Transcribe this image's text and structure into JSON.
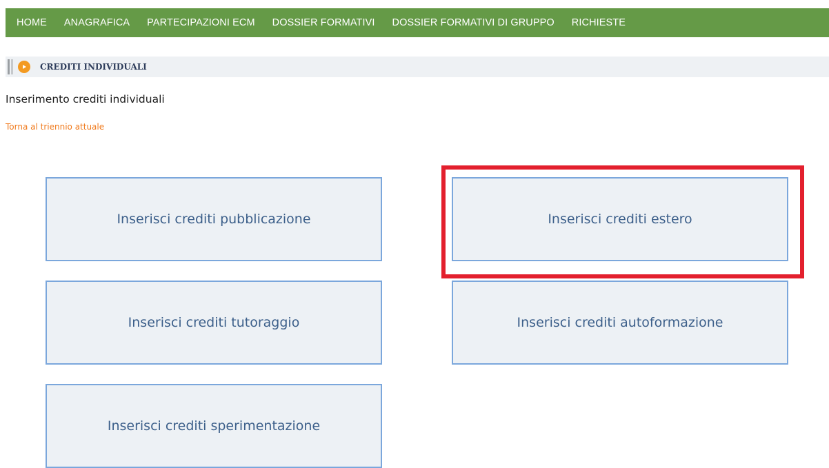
{
  "nav": {
    "items": [
      {
        "label": "HOME"
      },
      {
        "label": "ANAGRAFICA"
      },
      {
        "label": "PARTECIPAZIONI ECM"
      },
      {
        "label": "DOSSIER FORMATIVI"
      },
      {
        "label": "DOSSIER FORMATIVI DI GRUPPO"
      },
      {
        "label": "RICHIESTE"
      }
    ]
  },
  "section": {
    "icon": "arrow-right-circle-icon",
    "title": "CREDITI INDIVIDUALI"
  },
  "page": {
    "heading": "Inserimento crediti individuali",
    "back_link": "Torna al triennio attuale"
  },
  "tiles": [
    {
      "label": "Inserisci crediti pubblicazione"
    },
    {
      "label": "Inserisci crediti estero"
    },
    {
      "label": "Inserisci crediti tutoraggio"
    },
    {
      "label": "Inserisci crediti autoformazione"
    },
    {
      "label": "Inserisci crediti sperimentazione"
    }
  ],
  "colors": {
    "nav_bg": "#659a47",
    "link": "#f07a1c",
    "tile_border": "#7ba7dc",
    "highlight": "#e3202e"
  }
}
